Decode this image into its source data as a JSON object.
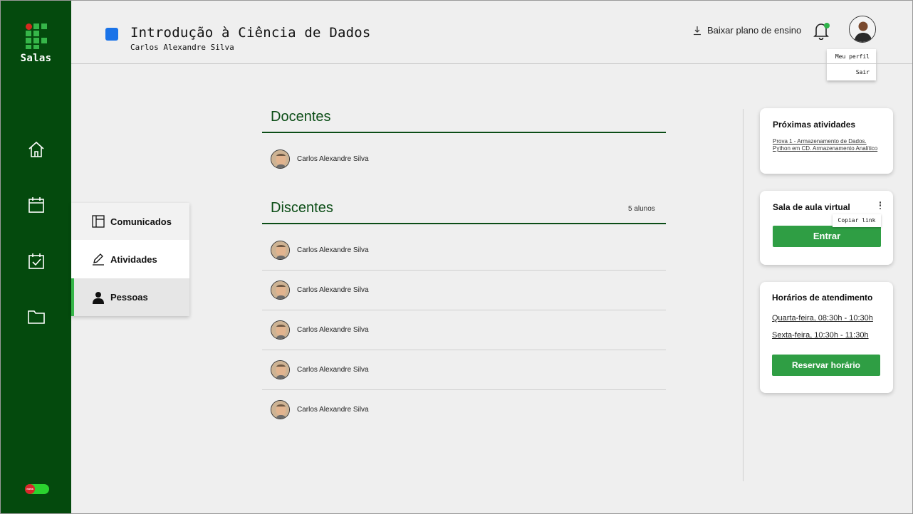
{
  "app": {
    "name": "Salas",
    "badge_label": "meta"
  },
  "header": {
    "course_title": "Introdução à Ciência de Dados",
    "course_teacher": "Carlos Alexandre Silva",
    "course_color": "#1a73e8",
    "download_label": "Baixar plano de ensino",
    "user_menu": [
      "Meu perfil",
      "Sair"
    ]
  },
  "sidebar": {
    "items": [
      {
        "name": "home",
        "icon": "home-icon"
      },
      {
        "name": "calendar",
        "icon": "calendar-icon"
      },
      {
        "name": "tasks",
        "icon": "calendar-check-icon"
      },
      {
        "name": "files",
        "icon": "folder-icon"
      }
    ]
  },
  "submenu": {
    "items": [
      {
        "label": "Comunicados",
        "icon": "board-icon"
      },
      {
        "label": "Atividades",
        "icon": "pencil-icon"
      },
      {
        "label": "Pessoas",
        "icon": "person-icon",
        "active": true
      }
    ]
  },
  "docentes": {
    "title": "Docentes",
    "people": [
      "Carlos Alexandre Silva"
    ]
  },
  "discentes": {
    "title": "Discentes",
    "count_label": "5 alunos",
    "people": [
      "Carlos Alexandre Silva",
      "Carlos Alexandre Silva",
      "Carlos Alexandre Silva",
      "Carlos Alexandre Silva",
      "Carlos Alexandre Silva"
    ]
  },
  "activities": {
    "title": "Próximas atividades",
    "links": [
      "Prova 1 - Armazenamento de Dados.",
      "Python em CD. Armazenamento Analítico"
    ]
  },
  "virtual_room": {
    "title": "Sala de aula virtual",
    "copy_link": "Copiar link",
    "enter_label": "Entrar"
  },
  "office_hours": {
    "title": "Horários de atendimento",
    "slots": [
      "Quarta-feira, 08:30h - 10:30h",
      "Sexta-feira, 10:30h - 11:30h"
    ],
    "reserve_label": "Reservar horário"
  },
  "colors": {
    "sidebar": "#044a0d",
    "accent_green": "#2f9e44",
    "heading_green": "#0b4d16"
  }
}
